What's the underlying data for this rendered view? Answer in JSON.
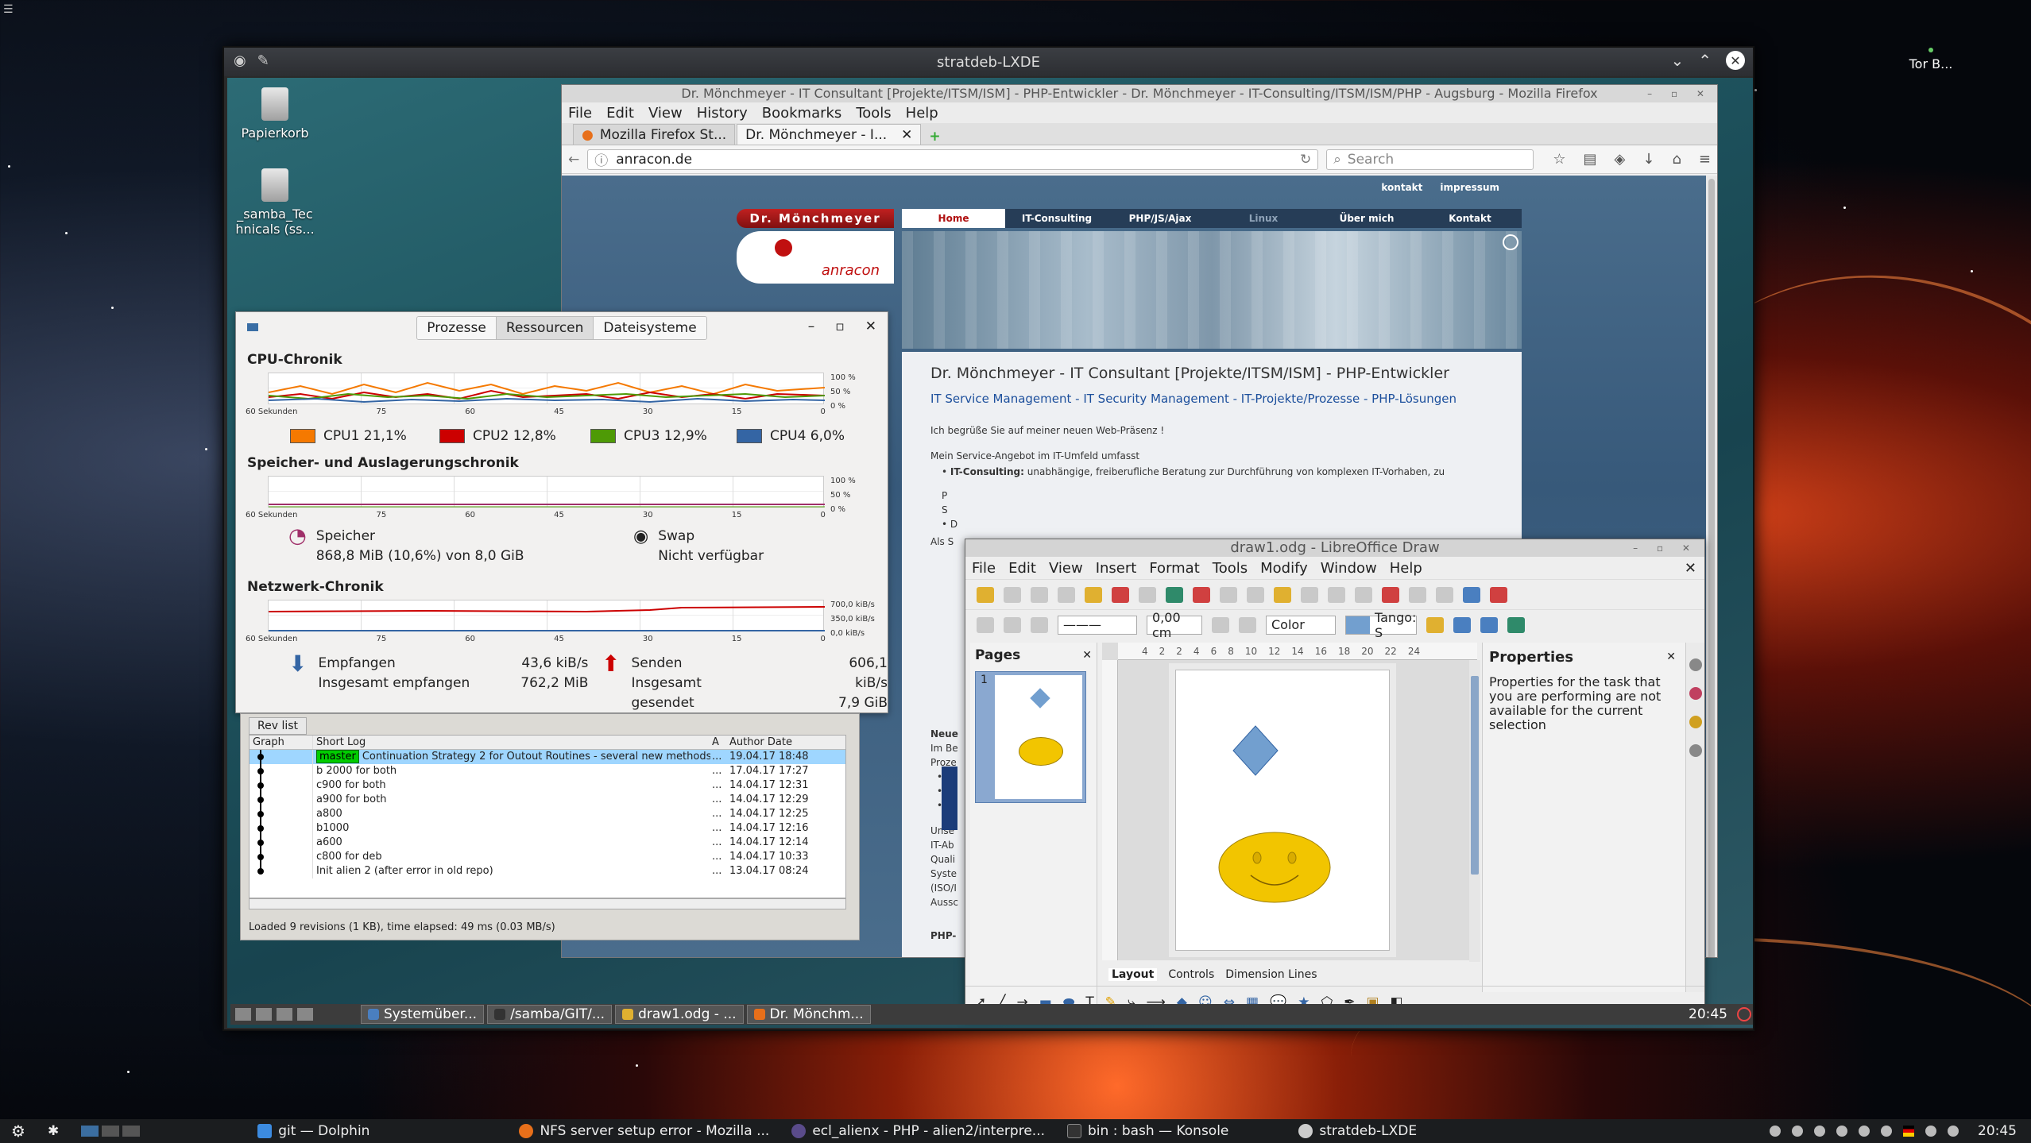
{
  "desktop": {
    "tor_label": "Tor B...",
    "outer_window_title": "stratdeb-LXDE",
    "icons": [
      {
        "label": "Papierkorb"
      },
      {
        "label": "_samba_Tec hnicals (ss..."
      }
    ]
  },
  "firefox": {
    "window_title": "Dr. Mönchmeyer - IT Consultant [Projekte/ITSM/ISM] - PHP-Entwickler - Dr. Mönchmeyer - IT-Consulting/ITSM/ISM/PHP - Augsburg - Mozilla Firefox",
    "menu": [
      "File",
      "Edit",
      "View",
      "History",
      "Bookmarks",
      "Tools",
      "Help"
    ],
    "tabs": [
      {
        "label": "Mozilla Firefox St..."
      },
      {
        "label": "Dr. Mönchmeyer - I..."
      }
    ],
    "url": "anracon.de",
    "search_placeholder": "Search",
    "site": {
      "top_links": [
        "kontakt",
        "impressum"
      ],
      "brand": "Dr. Mönchmeyer",
      "logo_text": "anracon",
      "nav": [
        "Home",
        "IT-Consulting",
        "PHP/JS/Ajax",
        "Linux",
        "Über mich",
        "Kontakt"
      ],
      "heading": "Dr. Mönchmeyer - IT Consultant [Projekte/ITSM/ISM] - PHP-Entwickler",
      "subheading": "IT Service Management - IT Security Management - IT-Projekte/Prozesse - PHP-Lösungen",
      "para1": "Ich begrüße Sie auf meiner neuen Web-Präsenz !",
      "para2": "Mein Service-Angebot im IT-Umfeld umfasst",
      "bullet1_bold": "IT-Consulting:",
      "bullet1": "unabhängige, freiberufliche Beratung zur Durchführung von komplexen IT-Vorhaben, zu",
      "frag_als": "Als S",
      "frag_neue": "Neue",
      "frag_im": "Im Be",
      "frag_proz": "Proze",
      "frag_unser": "Unse",
      "frag_itab": "IT-Ab",
      "frag_quali": "Quali",
      "frag_syst": "Syste",
      "frag_iso": "(ISO/I",
      "frag_auss": "Aussc",
      "frag_php": "PHP-"
    }
  },
  "sysmon": {
    "tabs": [
      "Prozesse",
      "Ressourcen",
      "Dateisysteme"
    ],
    "cpu_title": "CPU-Chronik",
    "mem_title": "Speicher- und Auslagerungschronik",
    "net_title": "Netzwerk-Chronik",
    "x_axis": [
      "60 Sekunden",
      "75",
      "60",
      "45",
      "30",
      "15",
      "0"
    ],
    "y_pct": [
      "100 %",
      "50 %",
      "0 %"
    ],
    "y_net": [
      "700,0 kiB/s",
      "350,0 kiB/s",
      "0,0 kiB/s"
    ],
    "cpus": [
      {
        "label": "CPU1 21,1%",
        "color": "#f57900"
      },
      {
        "label": "CPU2 12,8%",
        "color": "#cc0000"
      },
      {
        "label": "CPU3 12,9%",
        "color": "#4e9a06"
      },
      {
        "label": "CPU4 6,0%",
        "color": "#3465a4"
      }
    ],
    "mem_label": "Speicher",
    "mem_value": "868,8 MiB (10,6%) von 8,0 GiB",
    "swap_label": "Swap",
    "swap_value": "Nicht verfügbar",
    "recv_label": "Empfangen",
    "recv_value": "43,6 kiB/s",
    "recv_total_label": "Insgesamt empfangen",
    "recv_total": "762,2 MiB",
    "send_label": "Senden",
    "send_value": "606,1 kiB/s",
    "send_total_label": "Insgesamt gesendet",
    "send_total": "7,9 GiB"
  },
  "gitk": {
    "tab": "Rev list",
    "headers": [
      "Graph",
      "Short Log",
      "A",
      "Author Date"
    ],
    "master": "master",
    "rows": [
      {
        "log": "Continuation Strategy 2 for Outout Routines - several new methods",
        "a": "...",
        "date": "19.04.17 18:48"
      },
      {
        "log": "b 2000 for both",
        "a": "...",
        "date": "17.04.17 17:27"
      },
      {
        "log": "c900 for both",
        "a": "...",
        "date": "14.04.17 12:31"
      },
      {
        "log": "a900 for both",
        "a": "...",
        "date": "14.04.17 12:29"
      },
      {
        "log": "a800",
        "a": "...",
        "date": "14.04.17 12:25"
      },
      {
        "log": "b1000",
        "a": "...",
        "date": "14.04.17 12:16"
      },
      {
        "log": "a600",
        "a": "...",
        "date": "14.04.17 12:14"
      },
      {
        "log": "c800 for deb",
        "a": "...",
        "date": "14.04.17 10:33"
      },
      {
        "log": "Init alien 2 (after error in old repo)",
        "a": "...",
        "date": "13.04.17 08:24"
      }
    ],
    "status": "Loaded 9 revisions (1 KB),   time elapsed: 49 ms (0.03 MB/s)"
  },
  "draw": {
    "title": "draw1.odg - LibreOffice Draw",
    "menu": [
      "File",
      "Edit",
      "View",
      "Insert",
      "Format",
      "Tools",
      "Modify",
      "Window",
      "Help"
    ],
    "line_width": "0,00 cm",
    "area_style": "Color",
    "fill_color": "Tango: S",
    "pages_title": "Pages",
    "page_num": "1",
    "ruler": [
      "4",
      "2",
      "2",
      "4",
      "6",
      "8",
      "10",
      "12",
      "14",
      "16",
      "18",
      "20",
      "22",
      "24"
    ],
    "props_title": "Properties",
    "props_text": "Properties for the task that you are performing are not available for the current selection",
    "layer_tabs": [
      "Layout",
      "Controls",
      "Dimension Lines"
    ]
  },
  "inner_taskbar": {
    "items": [
      "Systemüber...",
      "/samba/GIT/...",
      "draw1.odg - ...",
      "Dr. Mönchm..."
    ],
    "clock": "20:45"
  },
  "outer_taskbar": {
    "items": [
      {
        "label": "git — Dolphin",
        "color": "#3c8be0"
      },
      {
        "label": "NFS server setup error - Mozilla ...",
        "color": "#e76f1a"
      },
      {
        "label": "ecl_alienx - PHP - alien2/interpre...",
        "color": "#5a4b8a"
      },
      {
        "label": "bin : bash — Konsole",
        "color": "#333333"
      },
      {
        "label": "stratdeb-LXDE",
        "color": "#cccccc"
      }
    ],
    "clock": "20:45"
  }
}
